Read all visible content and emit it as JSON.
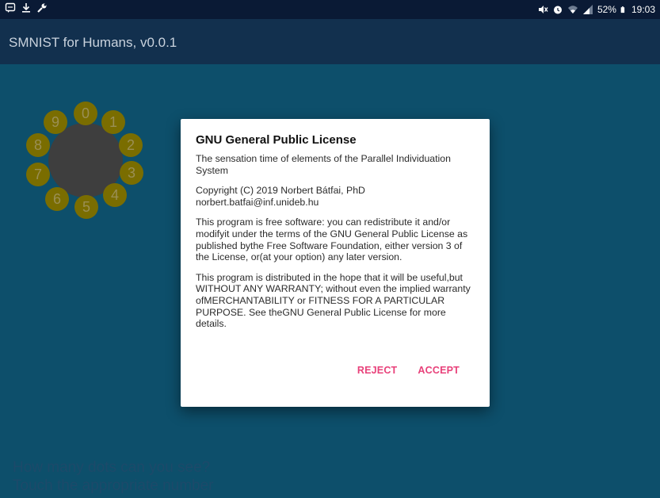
{
  "status_bar": {
    "left_icons": [
      "chat-icon",
      "download-icon",
      "wrench-icon"
    ],
    "right_icons": [
      "mute-icon",
      "alarm-icon",
      "wifi-icon",
      "signal-icon",
      "battery-icon"
    ],
    "battery_text": "52%",
    "time": "19:03"
  },
  "app_bar": {
    "title": "SMNIST for Humans, v0.0.1"
  },
  "wheel": {
    "digits": [
      "0",
      "1",
      "2",
      "3",
      "4",
      "5",
      "6",
      "7",
      "8",
      "9"
    ],
    "digit_color": "#7a6d00",
    "center_color": "#3e3e3e"
  },
  "prompt": {
    "line1": "How many dots can you see?",
    "line2": "Touch the appropriate number"
  },
  "dialog": {
    "title": "GNU General Public License",
    "paragraphs": [
      "The sensation time of elements of the Parallel Individuation System",
      "Copyright (C) 2019 Norbert Bátfai, PhD\nnorbert.batfai@inf.unideb.hu",
      "This program is free software: you can redistribute it and/or modifyit under the terms of the GNU General Public License as published bythe Free Software Foundation, either version 3 of the License, or(at your option) any later version.",
      "This program is distributed in the hope that it will be useful,but WITHOUT ANY WARRANTY; without even the implied warranty ofMERCHANTABILITY or FITNESS FOR A PARTICULAR PURPOSE.  See theGNU General Public License for more details."
    ],
    "reject_label": "REJECT",
    "accept_label": "ACCEPT",
    "accent_color": "#e8417a"
  },
  "colors": {
    "background": "#0d4f6b",
    "app_bar": "#12304e",
    "status_bar": "#0a1a35"
  }
}
